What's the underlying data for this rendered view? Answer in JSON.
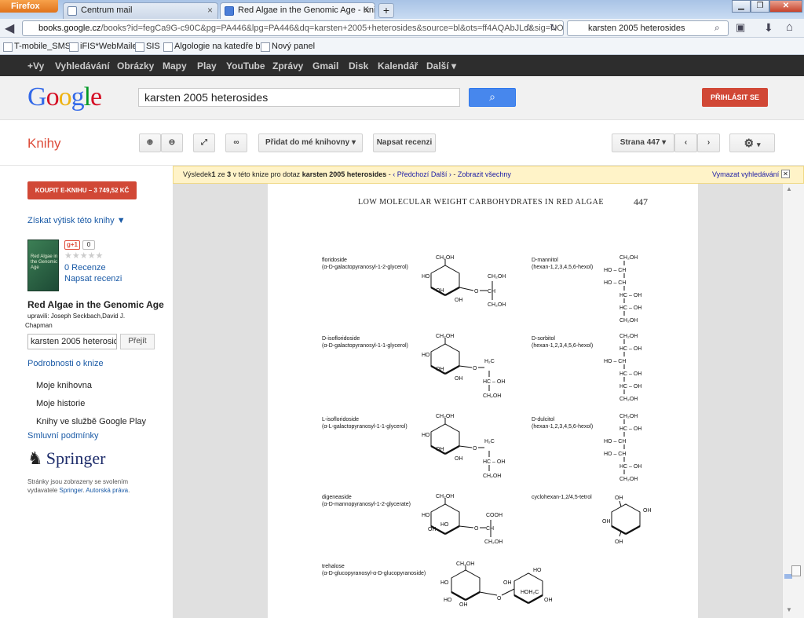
{
  "browser": {
    "app_button": "Firefox",
    "tabs": [
      {
        "label": "Centrum mail"
      },
      {
        "label": "Red Algae in the Genomic Age - Knih..."
      }
    ],
    "new_tab": "+",
    "url_domain": "books.google.cz",
    "url_rest": "/books?id=fegCa9G-c90C&pg=PA446&lpg=PA446&dq=karsten+2005+heterosides&source=bl&ots=ff4AQAbJLd&sig=NOo0",
    "search_value": "karsten 2005 heterosides",
    "bookmarks": [
      "T-mobile_SMS",
      "iFIS*WebMailer",
      "SIS",
      "Algologie na katedře b...",
      "Nový panel"
    ]
  },
  "gbar": [
    "+Vy",
    "Vyhledávání",
    "Obrázky",
    "Mapy",
    "Play",
    "YouTube",
    "Zprávy",
    "Gmail",
    "Disk",
    "Kalendář",
    "Další ▾"
  ],
  "header": {
    "logo": "Google",
    "search_value": "karsten 2005 heterosides",
    "signin": "PŘIHLÁSIT SE"
  },
  "toolbar": {
    "section": "Knihy",
    "add_library": "Přidat do mé knihovny",
    "write_review": "Napsat recenzi",
    "page_select": "Strana 447"
  },
  "sidebar": {
    "buy": "KOUPIT E-KNIHU – 3 749,52 KČ",
    "print_copy": "Získat výtisk této knihy ▼",
    "cover_text": "Red Algae in the Genomic Age",
    "gplus": "g+1",
    "gplus_count": "0",
    "stars": "★★★★★",
    "reviews": "0 Recenze",
    "write_review": "Napsat recenzi",
    "book_title": "Red Algae in the Genomic Age",
    "editors": "upravili: Joseph Seckbach,David J.",
    "editors2": "Chapman",
    "search_value": "karsten 2005 heteroside",
    "go": "Přejít",
    "details": "Podrobnosti o knize",
    "my_library": "Moje knihovna",
    "my_history": "Moje historie",
    "play_books": "Knihy ve službě Google Play",
    "terms": "Smluvní podmínky",
    "publisher": "Springer",
    "permission": "Stránky jsou zobrazeny se svolením vydavatele",
    "permission_publisher": "Springer",
    "copyright": "Autorská práva"
  },
  "results": {
    "prefix": "Výsledek",
    "index": "1",
    "middle": "ze",
    "total": "3",
    "text": "v této knize pro dotaz",
    "query": "karsten 2005 heterosides",
    "prev": "‹ Předchozí",
    "next": "Další ›",
    "show_all": "Zobrazit všechny",
    "clear": "Vymazat vyhledávání",
    "close": "✕"
  },
  "page": {
    "header": "LOW MOLECULAR WEIGHT CARBOHYDRATES IN RED ALGAE",
    "number": "447",
    "compounds": [
      {
        "name": "floridoside",
        "formula": "(α-D-galactopyranosyl-1-2-glycerol)"
      },
      {
        "name": "D-isofloridoside",
        "formula": "(α-D-galactopyranosyl-1-1-glycerol)"
      },
      {
        "name": "L-isofloridoside",
        "formula": "(α-L-galactopyranosyl-1-1-glycerol)"
      },
      {
        "name": "digeneaside",
        "formula": "(α-D-mannopyranosyl-1-2-glycerate)"
      },
      {
        "name": "trehalose",
        "formula": "(α-D-glucopyranosyl-α-D-glucopyranoside)"
      },
      {
        "name": "D-mannitol",
        "formula": "(hexan-1,2,3,4,5,6-hexol)"
      },
      {
        "name": "D-sorbitol",
        "formula": "(hexan-1,2,3,4,5,6-hexol)"
      },
      {
        "name": "D-dulcitol",
        "formula": "(hexan-1,2,3,4,5,6-hexol)"
      },
      {
        "name": "cyclohexan-1,2/4,5-tetrol",
        "formula": ""
      }
    ],
    "labels": {
      "ch2oh": "CH₂OH",
      "ho": "HO",
      "oh": "OH",
      "o": "O",
      "ch": "CH",
      "hc": "HC",
      "hc_oh": "HC – OH",
      "ho_ch": "HO – CH",
      "cooh": "COOH",
      "h2c": "H₂C",
      "hoh2c": "HOH₂C"
    }
  }
}
